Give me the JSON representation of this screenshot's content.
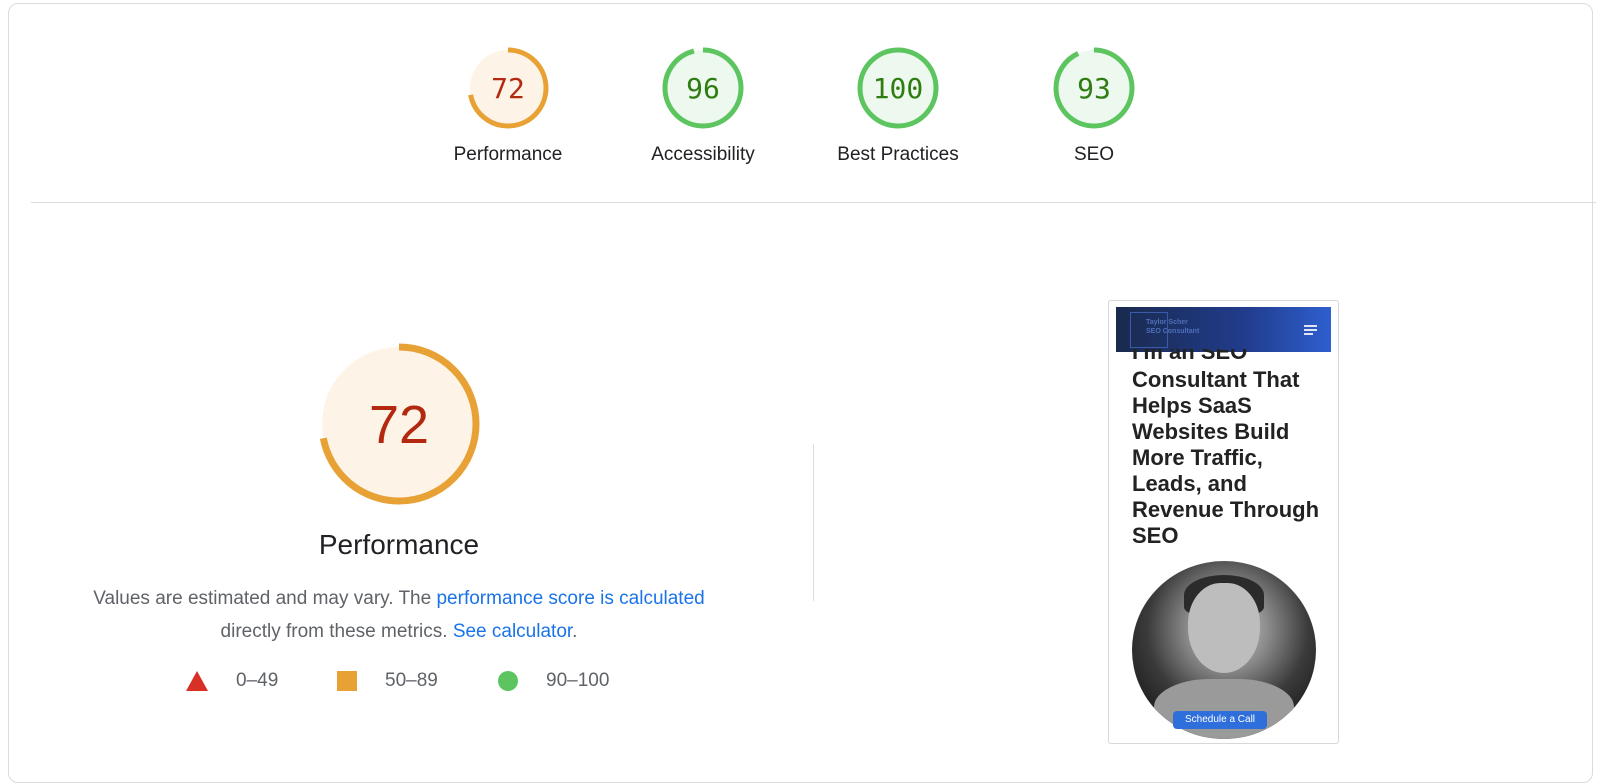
{
  "categories": [
    {
      "label": "Performance",
      "score": "72",
      "value": 72,
      "color": "#e8a135",
      "bg": "#fdf4e7",
      "text_color": "#b3290f"
    },
    {
      "label": "Accessibility",
      "score": "96",
      "value": 96,
      "color": "#5cc55f",
      "bg": "#edf8ee",
      "text_color": "#2f7d12"
    },
    {
      "label": "Best Practices",
      "score": "100",
      "value": 100,
      "color": "#5cc55f",
      "bg": "#edf8ee",
      "text_color": "#2f7d12"
    },
    {
      "label": "SEO",
      "score": "93",
      "value": 93,
      "color": "#5cc55f",
      "bg": "#edf8ee",
      "text_color": "#2f7d12"
    }
  ],
  "performance": {
    "score": "72",
    "value": 72,
    "title": "Performance",
    "desc_prefix": "Values are estimated and may vary. The ",
    "desc_link": "performance score is calculated",
    "desc_mid": " directly from these metrics. ",
    "calc_link": "See calculator",
    "desc_suffix": "."
  },
  "legend": {
    "fail": "0–49",
    "average": "50–89",
    "pass": "90–100"
  },
  "screenshot": {
    "logo_line1": "Taylor Scher",
    "logo_line2": "SEO Consultant",
    "headline_cut": "I'm an SEO",
    "headline": "Consultant That Helps SaaS Websites Build More Traffic, Leads, and Revenue Through SEO",
    "cta": "Schedule a Call"
  },
  "colors": {
    "average": "#e8a135",
    "pass": "#5cc55f",
    "fail": "#d93025",
    "link": "#1a73e8"
  }
}
